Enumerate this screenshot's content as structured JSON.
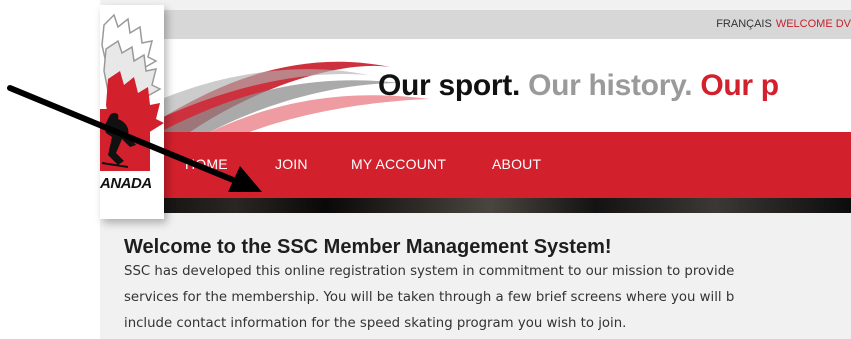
{
  "topbar": {
    "language_link": "FRANÇAIS",
    "welcome_text": "WELCOME DV"
  },
  "banner": {
    "tagline_part1": "Our sport.",
    "tagline_part2": "Our history.",
    "tagline_part3": "Our p"
  },
  "logo": {
    "wordmark": "ANADA"
  },
  "nav": {
    "items": [
      {
        "label": "HOME"
      },
      {
        "label": "JOIN"
      },
      {
        "label": "MY ACCOUNT"
      },
      {
        "label": "ABOUT"
      }
    ]
  },
  "content": {
    "title": "Welcome to the SSC Member Management System!",
    "lines": [
      "SSC has developed this online registration system in commitment to our mission to provide",
      "services for the membership. You will be taken through a few brief screens where you will b",
      "include contact information for the speed skating program you wish to join."
    ]
  },
  "colors": {
    "brand_red": "#d2202c",
    "topbar_gray": "#d7d7d7",
    "page_bg": "#f1f1f1"
  },
  "icons": [
    "maple-leaf-logo-icon",
    "skater-icon",
    "annotation-arrow"
  ]
}
